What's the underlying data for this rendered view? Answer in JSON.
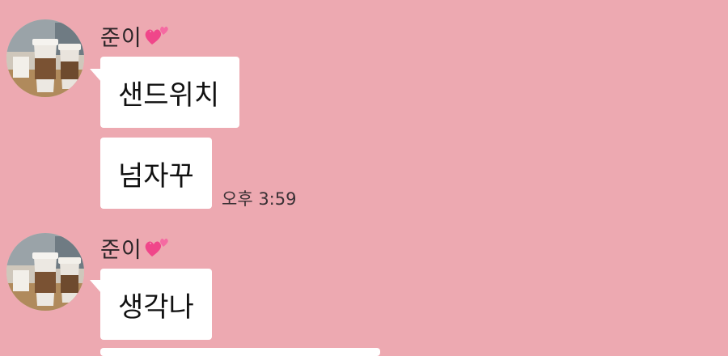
{
  "chat": {
    "messages_group_1": {
      "sender": "준이",
      "bubbles": [
        "샌드위치",
        "넘자꾸"
      ],
      "time": "오후 3:59"
    },
    "messages_group_2": {
      "sender": "준이",
      "bubbles": [
        "생각나"
      ]
    }
  },
  "theme": {
    "background": "#EDA9B1",
    "bubble": "#FFFFFF",
    "heart": "#F0468A"
  },
  "icons": {
    "sender_badge": "two-hearts-icon",
    "avatar": "coffee-cups-photo"
  }
}
